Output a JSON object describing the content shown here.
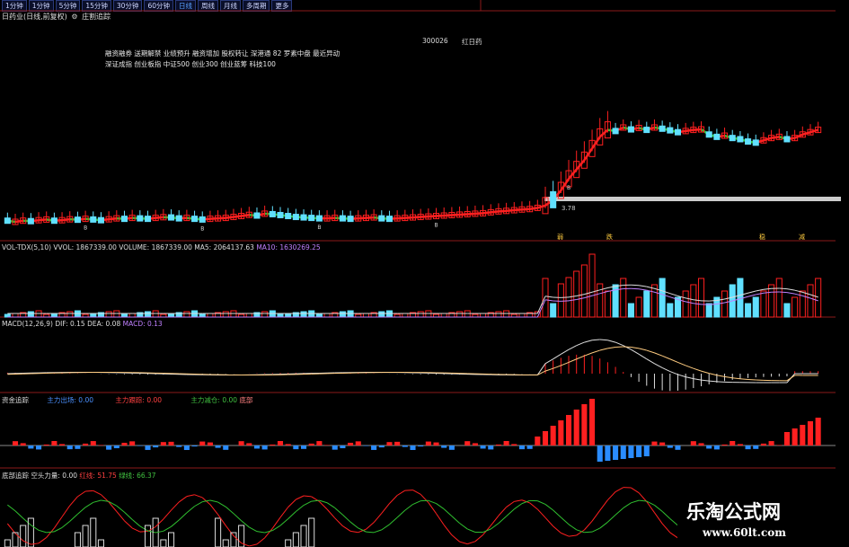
{
  "toolbar": {
    "periods": [
      "1分钟",
      "1分钟",
      "5分钟",
      "15分钟",
      "30分钟",
      "60分钟",
      "日线",
      "周线",
      "月线",
      "多周期",
      "更多"
    ]
  },
  "chart_title": "日药业(日线,前复权)",
  "chart_title_suffix": "庄割追踪",
  "stock_code": "300026",
  "stock_code_suffix": "红日药",
  "info_lines": [
    "融资融券 送期解禁 业绩预升 融资增加 股权转让 深港通 82 罗素中盘 最近异动",
    "深证成指 创业板指 中证500 创业300 创业蓝筹 科技100"
  ],
  "price_labels": {
    "level": "3.78",
    "marker": "B"
  },
  "event_labels": [
    "弱",
    "跌",
    "稳",
    "减"
  ],
  "volume_panel": {
    "name": "VOL-TDX(5,10)",
    "vvol": "VVOL: 1867339.00",
    "volume": "VOLUME: 1867339.00",
    "ma5": "MA5: 2064137.63",
    "ma10": "MA10: 1630269.25",
    "ma10_color": "#c080ff"
  },
  "macd_panel": {
    "name": "MACD(12,26,9)",
    "dif": "DIF: 0.15",
    "dea": "DEA: 0.08",
    "macd": "MACD: 0.13",
    "macd_color": "#c080ff"
  },
  "fund_panel": {
    "name": "资金追踪",
    "outflow": "主力出场: 0.00",
    "tracking": "主力跟踪: 0.00",
    "position": "主力减仓: 0.00",
    "bottom": "底部",
    "outflow_color": "#4a90ff",
    "tracking_color": "#ff4040",
    "position_color": "#40c040",
    "bottom_color": "#ff8080"
  },
  "osc_panel": {
    "name": "底部追踪",
    "power": "空头力量: 0.00",
    "red": "红线: 51.75",
    "green": "绿线: 66.37",
    "red_color": "#ff4040",
    "green_color": "#40c040"
  },
  "colors": {
    "up": "#ff2020",
    "down": "#60e0ff",
    "green": "#30c030",
    "bg": "#000000"
  },
  "watermark": {
    "line1": "乐淘公式网",
    "line2": "www.60lt.com"
  },
  "candles": {
    "series": [
      [
        3.5,
        -1
      ],
      [
        3.45,
        1
      ],
      [
        3.5,
        1
      ],
      [
        3.48,
        -1
      ],
      [
        3.52,
        1
      ],
      [
        3.55,
        1
      ],
      [
        3.5,
        -1
      ],
      [
        3.52,
        1
      ],
      [
        3.56,
        1
      ],
      [
        3.54,
        -1
      ],
      [
        3.58,
        1
      ],
      [
        3.55,
        -1
      ],
      [
        3.52,
        -1
      ],
      [
        3.56,
        1
      ],
      [
        3.6,
        1
      ],
      [
        3.58,
        -1
      ],
      [
        3.62,
        1
      ],
      [
        3.6,
        -1
      ],
      [
        3.58,
        -1
      ],
      [
        3.62,
        1
      ],
      [
        3.65,
        1
      ],
      [
        3.64,
        -1
      ],
      [
        3.6,
        -1
      ],
      [
        3.62,
        1
      ],
      [
        3.58,
        -1
      ],
      [
        3.55,
        -1
      ],
      [
        3.58,
        1
      ],
      [
        3.6,
        1
      ],
      [
        3.62,
        1
      ],
      [
        3.66,
        1
      ],
      [
        3.7,
        1
      ],
      [
        3.75,
        1
      ],
      [
        3.72,
        -1
      ],
      [
        3.8,
        1
      ],
      [
        3.78,
        -1
      ],
      [
        3.74,
        -1
      ],
      [
        3.7,
        -1
      ],
      [
        3.66,
        -1
      ],
      [
        3.64,
        -1
      ],
      [
        3.62,
        -1
      ],
      [
        3.6,
        -1
      ],
      [
        3.6,
        1
      ],
      [
        3.62,
        1
      ],
      [
        3.6,
        -1
      ],
      [
        3.58,
        -1
      ],
      [
        3.6,
        1
      ],
      [
        3.62,
        1
      ],
      [
        3.64,
        1
      ],
      [
        3.6,
        -1
      ],
      [
        3.58,
        -1
      ],
      [
        3.6,
        1
      ],
      [
        3.62,
        1
      ],
      [
        3.64,
        1
      ],
      [
        3.66,
        1
      ],
      [
        3.68,
        1
      ],
      [
        3.7,
        1
      ],
      [
        3.72,
        1
      ],
      [
        3.74,
        1
      ],
      [
        3.76,
        1
      ],
      [
        3.78,
        1
      ],
      [
        3.8,
        1
      ],
      [
        3.82,
        1
      ],
      [
        3.86,
        1
      ],
      [
        3.9,
        1
      ],
      [
        3.92,
        1
      ],
      [
        3.95,
        1
      ],
      [
        3.98,
        1
      ],
      [
        4.0,
        1
      ],
      [
        4.05,
        1
      ],
      [
        4.15,
        1
      ],
      [
        4.4,
        -1
      ],
      [
        4.8,
        1
      ],
      [
        5.3,
        1
      ],
      [
        5.7,
        1
      ],
      [
        6.1,
        1
      ],
      [
        6.6,
        1
      ],
      [
        7.1,
        1
      ],
      [
        7.4,
        1
      ],
      [
        7.35,
        -1
      ],
      [
        7.5,
        1
      ],
      [
        7.42,
        -1
      ],
      [
        7.48,
        1
      ],
      [
        7.4,
        -1
      ],
      [
        7.5,
        1
      ],
      [
        7.45,
        -1
      ],
      [
        7.38,
        -1
      ],
      [
        7.3,
        -1
      ],
      [
        7.35,
        1
      ],
      [
        7.4,
        1
      ],
      [
        7.42,
        1
      ],
      [
        7.2,
        -1
      ],
      [
        7.1,
        -1
      ],
      [
        7.15,
        1
      ],
      [
        7.05,
        -1
      ],
      [
        7.0,
        -1
      ],
      [
        6.9,
        -1
      ],
      [
        6.85,
        -1
      ],
      [
        6.95,
        1
      ],
      [
        7.05,
        1
      ],
      [
        7.1,
        1
      ],
      [
        7.0,
        -1
      ],
      [
        7.05,
        1
      ],
      [
        7.2,
        1
      ],
      [
        7.3,
        1
      ],
      [
        7.4,
        1
      ]
    ]
  }
}
